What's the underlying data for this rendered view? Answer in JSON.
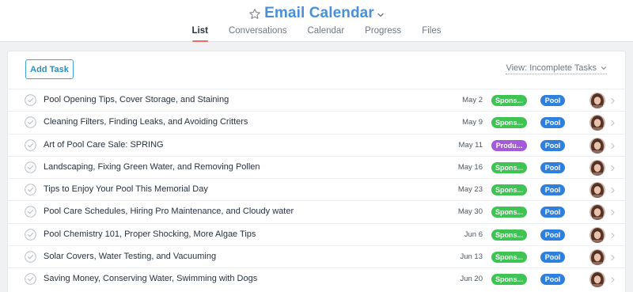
{
  "header": {
    "project_title": "Email Calendar",
    "tabs": [
      {
        "label": "List",
        "active": true
      },
      {
        "label": "Conversations",
        "active": false
      },
      {
        "label": "Calendar",
        "active": false
      },
      {
        "label": "Progress",
        "active": false
      },
      {
        "label": "Files",
        "active": false
      }
    ]
  },
  "toolbar": {
    "add_task_label": "Add Task",
    "view_filter_label": "View: Incomplete Tasks"
  },
  "colors": {
    "title_blue": "#4a90d9",
    "active_tab_underline": "#f06a6a",
    "sponsored_tag": "#3fc453",
    "product_tag": "#a55ad6",
    "pool_tag": "#2f7fdc",
    "add_task_border": "#3aa5cf"
  },
  "tasks": [
    {
      "name": "Pool Opening Tips, Cover Storage, and Staining",
      "date": "May 2",
      "type_tag": "Spons...",
      "type_kind": "sponsored",
      "project_tag": "Pool"
    },
    {
      "name": "Cleaning Filters, Finding Leaks, and Avoiding Critters",
      "date": "May 9",
      "type_tag": "Spons...",
      "type_kind": "sponsored",
      "project_tag": "Pool"
    },
    {
      "name": "Art of Pool Care Sale: SPRING",
      "date": "May 11",
      "type_tag": "Produ...",
      "type_kind": "product",
      "project_tag": "Pool"
    },
    {
      "name": "Landscaping, Fixing Green Water, and Removing Pollen",
      "date": "May 16",
      "type_tag": "Spons...",
      "type_kind": "sponsored",
      "project_tag": "Pool"
    },
    {
      "name": "Tips to Enjoy Your Pool This Memorial Day",
      "date": "May 23",
      "type_tag": "Spons...",
      "type_kind": "sponsored",
      "project_tag": "Pool"
    },
    {
      "name": "Pool Care Schedules, Hiring Pro Maintenance, and Cloudy water",
      "date": "May 30",
      "type_tag": "Spons...",
      "type_kind": "sponsored",
      "project_tag": "Pool"
    },
    {
      "name": "Pool Chemistry 101, Proper Shocking, More Algae Tips",
      "date": "Jun 6",
      "type_tag": "Spons...",
      "type_kind": "sponsored",
      "project_tag": "Pool"
    },
    {
      "name": "Solar Covers, Water Testing, and Vacuuming",
      "date": "Jun 13",
      "type_tag": "Spons...",
      "type_kind": "sponsored",
      "project_tag": "Pool"
    },
    {
      "name": "Saving Money, Conserving Water, Swimming with Dogs",
      "date": "Jun 20",
      "type_tag": "Spons...",
      "type_kind": "sponsored",
      "project_tag": "Pool"
    }
  ],
  "icons": {
    "favorite": "star-icon",
    "title_menu": "chevron-down-icon",
    "view_menu": "chevron-down-icon",
    "task_complete": "checkmark-circle-icon",
    "assignee": "avatar",
    "row_details": "chevron-right-icon"
  }
}
